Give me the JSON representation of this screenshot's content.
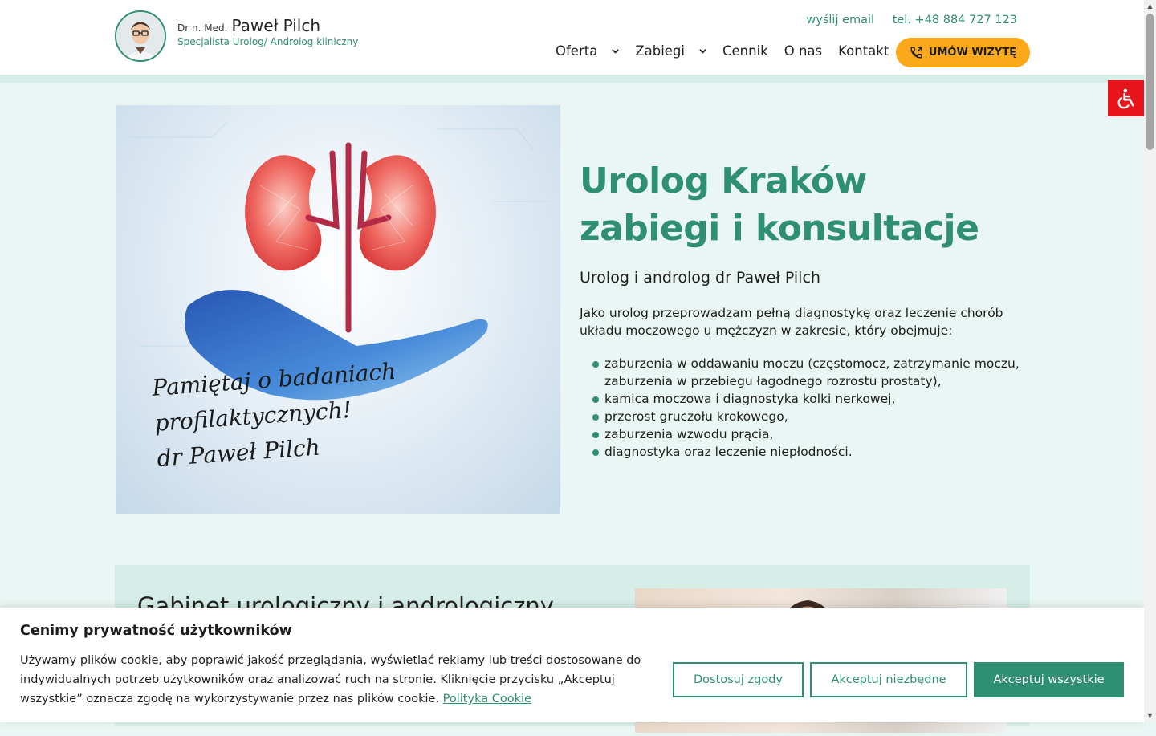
{
  "brand": {
    "prefix": "Dr n. Med.",
    "name": "Paweł Pilch",
    "subtitle": "Specjalista Urolog/ Androlog kliniczny"
  },
  "top_links": {
    "email": "wyślij email",
    "phone": "tel. +48 884 727 123"
  },
  "nav": {
    "items": [
      {
        "label": "Oferta",
        "has_dropdown": true
      },
      {
        "label": "Zabiegi",
        "has_dropdown": true
      },
      {
        "label": "Cennik",
        "has_dropdown": false
      },
      {
        "label": "O nas",
        "has_dropdown": false
      },
      {
        "label": "Kontakt",
        "has_dropdown": false
      }
    ],
    "cta_label": "UMÓW WIZYTĘ"
  },
  "hero": {
    "image_caption": [
      "Pamiętaj o badaniach",
      "profilaktycznych!",
      "dr Paweł Pilch"
    ],
    "title_line1": "Urolog Kraków",
    "title_line2": "zabiegi i konsultacje",
    "subtitle": "Urolog i androlog dr Paweł Pilch",
    "description": "Jako urolog przeprowadzam pełną diagnostykę oraz leczenie chorób układu moczowego u mężczyzn w zakresie, który obejmuje:",
    "list": [
      "zaburzenia w oddawaniu moczu (częstomocz, zatrzymanie moczu, zaburzenia w przebiegu łagodnego rozrostu prostaty),",
      "kamica moczowa i diagnostyka kolki nerkowej,",
      "przerost gruczołu krokowego,",
      "zaburzenia wzwodu prącia,",
      "diagnostyka oraz leczenie niepłodności."
    ]
  },
  "section2": {
    "title": "Gabinet urologiczny i andrologiczny"
  },
  "cookie": {
    "title": "Cenimy prywatność użytkowników",
    "text": "Używamy plików cookie, aby poprawić jakość przeglądania, wyświetlać reklamy lub treści dostosowane do indywidualnych potrzeb użytkowników oraz analizować ruch na stronie. Kliknięcie przycisku „Akceptuj wszystkie” oznacza zgodę na wykorzystywanie przez nas plików cookie.",
    "link": "Polityka Cookie",
    "btn_customize": "Dostosuj zgody",
    "btn_necessary": "Akceptuj niezbędne",
    "btn_all": "Akceptuj wszystkie"
  },
  "colors": {
    "accent": "#2e8f72",
    "cta": "#fba81a",
    "accessibility": "#e8141b",
    "background": "#eaf6f3"
  },
  "icons": [
    "chevron-down-icon",
    "phone-icon",
    "accessibility-icon"
  ]
}
